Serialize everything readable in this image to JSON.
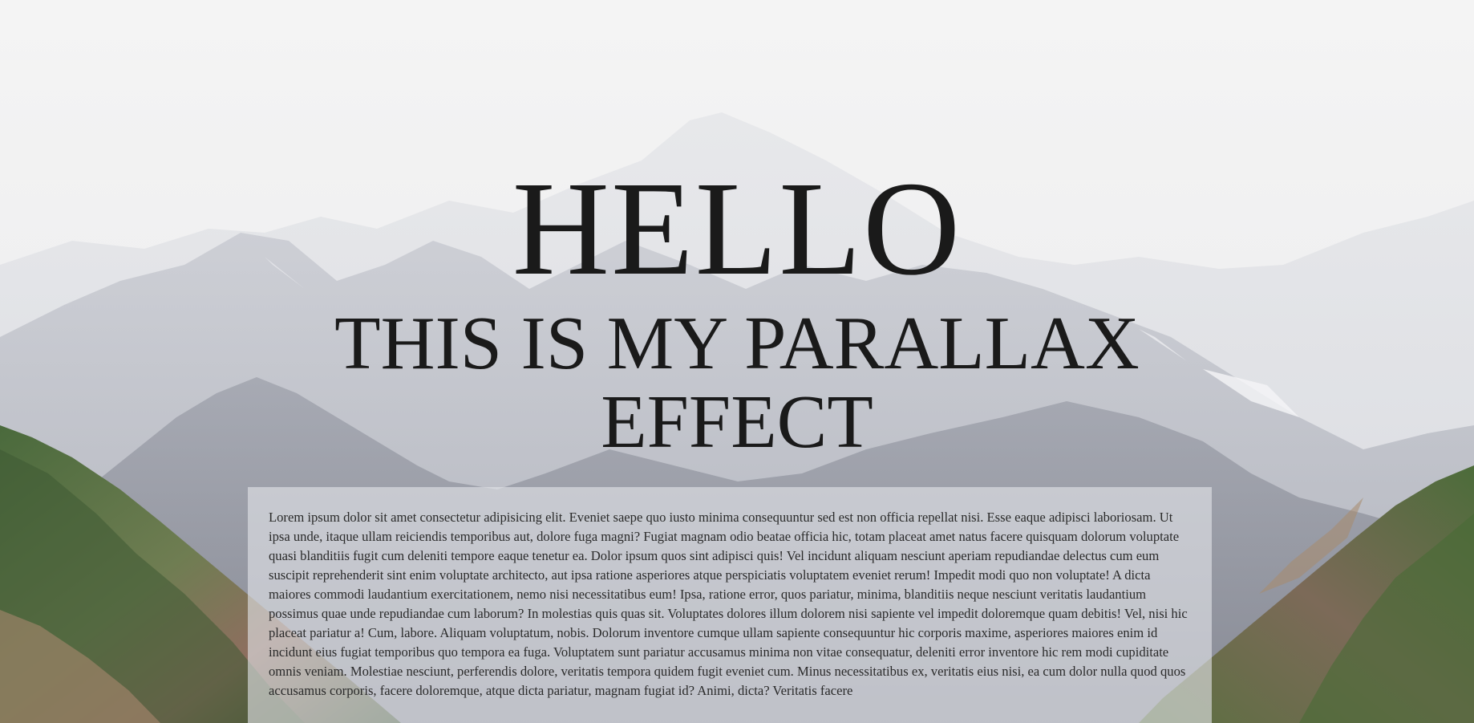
{
  "hero": {
    "title": "HELLO",
    "subtitle": "THIS IS MY PARALLAX EFFECT"
  },
  "content": {
    "paragraph": "Lorem ipsum dolor sit amet consectetur adipisicing elit. Eveniet saepe quo iusto minima consequuntur sed est non officia repellat nisi. Esse eaque adipisci laboriosam. Ut ipsa unde, itaque ullam reiciendis temporibus aut, dolore fuga magni? Fugiat magnam odio beatae officia hic, totam placeat amet natus facere quisquam dolorum voluptate quasi blanditiis fugit cum deleniti tempore eaque tenetur ea. Dolor ipsum quos sint adipisci quis! Vel incidunt aliquam nesciunt aperiam repudiandae delectus cum eum suscipit reprehenderit sint enim voluptate architecto, aut ipsa ratione asperiores atque perspiciatis voluptatem eveniet rerum! Impedit modi quo non voluptate! A dicta maiores commodi laudantium exercitationem, nemo nisi necessitatibus eum! Ipsa, ratione error, quos pariatur, minima, blanditiis neque nesciunt veritatis laudantium possimus quae unde repudiandae cum laborum? In molestias quis quas sit. Voluptates dolores illum dolorem nisi sapiente vel impedit doloremque quam debitis! Vel, nisi hic placeat pariatur a! Cum, labore. Aliquam voluptatum, nobis. Dolorum inventore cumque ullam sapiente consequuntur hic corporis maxime, asperiores maiores enim id incidunt eius fugiat temporibus quo tempora ea fuga. Voluptatem sunt pariatur accusamus minima non vitae consequatur, deleniti error inventore hic rem modi cupiditate omnis veniam. Molestiae nesciunt, perferendis dolore, veritatis tempora quidem fugit eveniet cum. Minus necessitatibus ex, veritatis eius nisi, ea cum dolor nulla quod quos accusamus corporis, facere doloremque, atque dicta pariatur, magnam fugiat id? Animi, dicta? Veritatis facere"
  },
  "background": {
    "description_icon": "mountain-landscape-image",
    "sky_color": "#f1f1f2",
    "far_mountain_color": "#dcdde2",
    "mid_mountain_color": "#b9bbc3",
    "near_mountain_color": "#8e9099",
    "forest_color": "#3f5b35",
    "rock_color": "#8a7565"
  }
}
